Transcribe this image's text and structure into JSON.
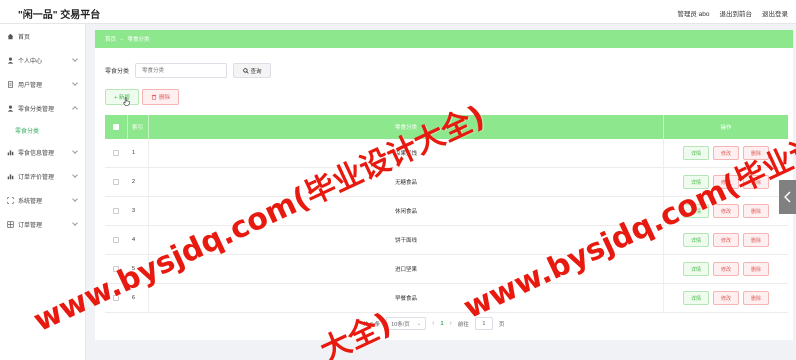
{
  "header": {
    "title": "\"闲一品\" 交易平台",
    "admin_label": "管理员 abo",
    "back_front": "退出到前台",
    "logout": "退出登录"
  },
  "sidebar": {
    "items": [
      {
        "label": "首页",
        "icon": "home-icon"
      },
      {
        "label": "个人中心",
        "icon": "user-icon"
      },
      {
        "label": "用户管理",
        "icon": "doc-icon"
      },
      {
        "label": "零食分类管理",
        "icon": "user-icon"
      },
      {
        "label": "零食信息管理",
        "icon": "bar-chart-icon"
      },
      {
        "label": "订单评价管理",
        "icon": "bar-chart-icon"
      },
      {
        "label": "系统管理",
        "icon": "expand-icon"
      },
      {
        "label": "订单管理",
        "icon": "grid-icon"
      }
    ],
    "active_sub": "零食分类"
  },
  "breadcrumb": {
    "home": "首页",
    "arrow": "→",
    "current": "零食分类"
  },
  "search": {
    "label": "零食分类",
    "placeholder": "零食分类",
    "query_button": "查询"
  },
  "actions": {
    "add": "+ 新增",
    "delete": "删除"
  },
  "table": {
    "headers": {
      "index": "索引",
      "name": "零食分类",
      "ops": "操作"
    },
    "rows": [
      {
        "index": "1",
        "name": "凉果蜜饯"
      },
      {
        "index": "2",
        "name": "无糖食品"
      },
      {
        "index": "3",
        "name": "休闲食品"
      },
      {
        "index": "4",
        "name": "饼干面线"
      },
      {
        "index": "5",
        "name": "进口坚果"
      },
      {
        "index": "6",
        "name": "早餐食品"
      }
    ],
    "op_labels": {
      "detail": "详情",
      "edit": "修改",
      "delete": "删除"
    }
  },
  "pagination": {
    "total": "共 6 条",
    "page_size": "10条/页",
    "current_page": "1",
    "goto_label": "前往",
    "goto_value": "1",
    "page_unit": "页"
  },
  "watermark": {
    "text1": "www.bysjdq.com(毕业设计大全)",
    "text2": "www.bysjdq.com(毕业设计大全)",
    "text3": "大全)"
  },
  "colors": {
    "accent_green": "#8de88d",
    "success_text": "#46b946",
    "danger_text": "#e25b5b",
    "watermark_red": "#e8190f"
  }
}
